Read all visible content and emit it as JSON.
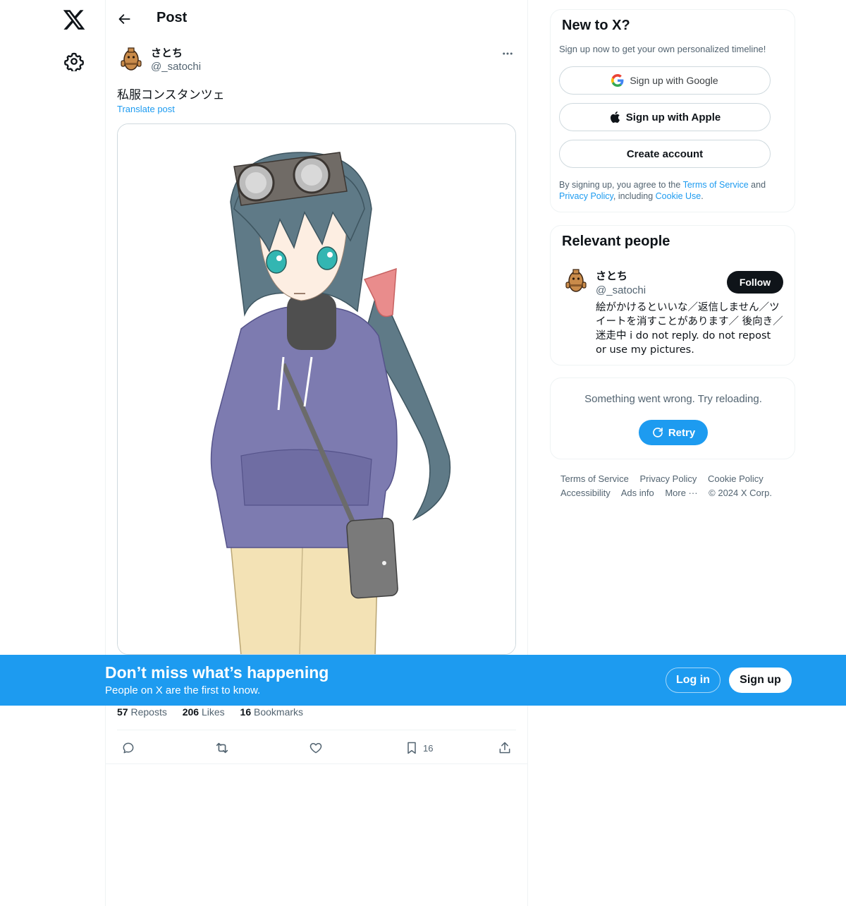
{
  "nav": {
    "logo_icon": "x-logo-icon",
    "settings_icon": "gear-icon"
  },
  "header": {
    "title": "Post",
    "back_icon": "arrow-left-icon"
  },
  "post": {
    "author_name": "さとち",
    "author_handle": "@_satochi",
    "text": "私服コンスタンツェ",
    "translate_label": "Translate post",
    "media_alt": "illustration of a character in a hoodie with goggles",
    "stats": {
      "reposts_count": "57",
      "reposts_label": "Reposts",
      "likes_count": "206",
      "likes_label": "Likes",
      "bookmarks_count": "16",
      "bookmarks_label": "Bookmarks"
    },
    "actions": {
      "reply_icon": "reply-icon",
      "repost_icon": "repost-icon",
      "like_icon": "heart-icon",
      "bookmark_icon": "bookmark-icon",
      "bookmark_count": "16",
      "share_icon": "share-icon"
    }
  },
  "signup_card": {
    "title": "New to X?",
    "subtitle": "Sign up now to get your own personalized timeline!",
    "google_label": "Sign up with Google",
    "apple_label": "Sign up with Apple",
    "create_label": "Create account",
    "legal_prefix": "By signing up, you agree to the ",
    "terms_link": "Terms of Service",
    "legal_and": " and",
    "privacy_link": "Privacy Policy",
    "legal_including": ", including ",
    "cookie_link": "Cookie Use",
    "legal_end": "."
  },
  "relevant_people": {
    "title": "Relevant people",
    "name": "さとち",
    "handle": "@_satochi",
    "follow_label": "Follow",
    "bio": "絵がかけるといいな／返信しません／ツイートを消すことがあります／ 後向き／迷走中 i do not reply. do not repost or use my pictures."
  },
  "error_card": {
    "message": "Something went wrong. Try reloading.",
    "retry_label": "Retry"
  },
  "footer": {
    "links": [
      "Terms of Service",
      "Privacy Policy",
      "Cookie Policy",
      "Accessibility",
      "Ads info",
      "More ···",
      "© 2024 X Corp."
    ]
  },
  "banner": {
    "title": "Don’t miss what’s happening",
    "subtitle": "People on X are the first to know.",
    "login_label": "Log in",
    "signup_label": "Sign up"
  },
  "colors": {
    "accent": "#1d9bf0",
    "text": "#0f1419",
    "muted": "#536471",
    "border": "#eff3f4"
  }
}
